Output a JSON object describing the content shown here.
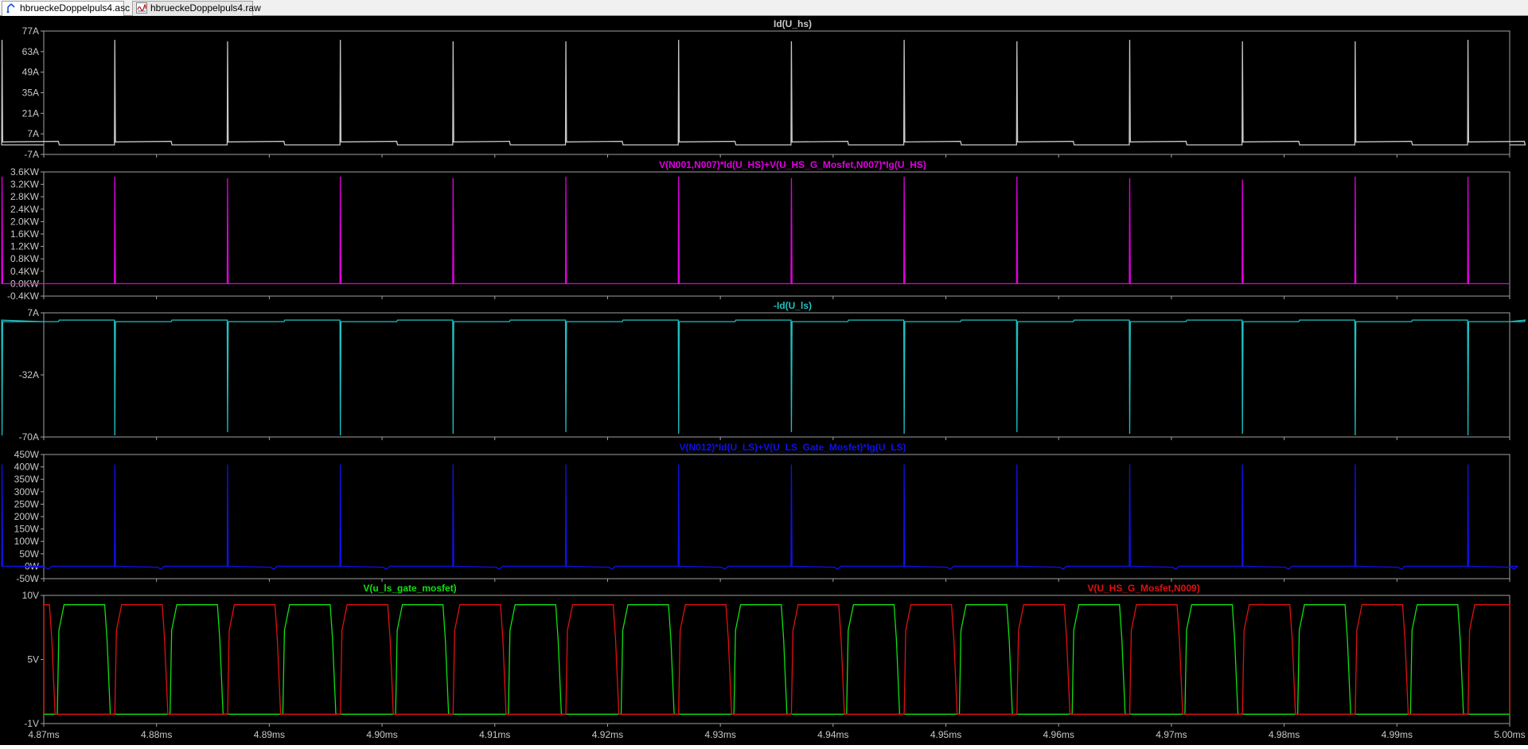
{
  "tabs": [
    {
      "label": "hbrueckeDoppelpuls4.asc",
      "icon": "schematic-icon",
      "active": true
    },
    {
      "label": "hbrueckeDoppelpuls4.raw",
      "icon": "waveform-icon",
      "active": false
    }
  ],
  "x_axis": {
    "range": [
      4.87,
      5.0
    ],
    "ticks": [
      "4.87ms",
      "4.88ms",
      "4.89ms",
      "4.90ms",
      "4.91ms",
      "4.92ms",
      "4.93ms",
      "4.94ms",
      "4.95ms",
      "4.96ms",
      "4.97ms",
      "4.98ms",
      "4.99ms",
      "5.00ms"
    ]
  },
  "chart_data": [
    {
      "type": "line",
      "series": [
        {
          "name": "Id(U_hs)",
          "color": "#c8c8c8",
          "unit": "A"
        }
      ],
      "ylim": [
        -7,
        77
      ],
      "yticks": [
        "77A",
        "63A",
        "49A",
        "35A",
        "21A",
        "7A",
        "-7A"
      ],
      "x": [
        4.8663,
        4.8763,
        4.8863,
        4.8963,
        4.9063,
        4.9163,
        4.9263,
        4.9363,
        4.9463,
        4.9563,
        4.9663,
        4.9763,
        4.9863,
        4.9963
      ],
      "peaks": [
        71,
        71,
        70,
        71,
        70,
        70,
        71,
        70,
        71,
        70,
        71,
        70,
        70,
        71
      ],
      "period_ms": 0.01,
      "on_ms": 0.005,
      "baseline_on": 1.5,
      "baseline_off": -0.5
    },
    {
      "type": "line",
      "series": [
        {
          "name": "V(N001,N007)*Id(U_HS)+V(U_HS_G_Mosfet,N007)*Ig(U_HS)",
          "color": "#e000e0",
          "unit": "W"
        }
      ],
      "ylim": [
        -0.4,
        3.6
      ],
      "yticks": [
        "3.6KW",
        "3.2KW",
        "2.8KW",
        "2.4KW",
        "2.0KW",
        "1.6KW",
        "1.2KW",
        "0.8KW",
        "0.4KW",
        "0.0KW",
        "-0.4KW"
      ],
      "x": [
        4.8663,
        4.8763,
        4.8863,
        4.8963,
        4.9063,
        4.9163,
        4.9263,
        4.9363,
        4.9463,
        4.9563,
        4.9663,
        4.9763,
        4.9863,
        4.9963
      ],
      "peaks": [
        3.45,
        3.45,
        3.4,
        3.45,
        3.4,
        3.45,
        3.45,
        3.4,
        3.45,
        3.45,
        3.4,
        3.35,
        3.45,
        3.45
      ],
      "baseline": 0.0
    },
    {
      "type": "line",
      "series": [
        {
          "name": "-Id(U_ls)",
          "color": "#20c0c0",
          "unit": "A"
        }
      ],
      "ylim": [
        -70,
        7
      ],
      "yticks": [
        "7A",
        "-32A",
        "-70A"
      ],
      "x": [
        4.8663,
        4.8763,
        4.8863,
        4.8963,
        4.9063,
        4.9163,
        4.9263,
        4.9363,
        4.9463,
        4.9563,
        4.9663,
        4.9763,
        4.9863,
        4.9963
      ],
      "troughs": [
        -69,
        -69,
        -67,
        -69,
        -68,
        -67,
        -68,
        -67,
        -68,
        -67,
        -68,
        -68,
        -69,
        -69
      ],
      "baseline_on": 2.5,
      "baseline_off": 1.5
    },
    {
      "type": "line",
      "series": [
        {
          "name": "V(N012)*Id(U_LS)+V(U_LS_Gate_Mosfet)*Ig(U_LS)",
          "color": "#1010e8",
          "unit": "W"
        }
      ],
      "ylim": [
        -50,
        450
      ],
      "yticks": [
        "450W",
        "400W",
        "350W",
        "300W",
        "250W",
        "200W",
        "150W",
        "100W",
        "50W",
        "0W",
        "-50W"
      ],
      "x": [
        4.8663,
        4.8763,
        4.8863,
        4.8963,
        4.9063,
        4.9163,
        4.9263,
        4.9363,
        4.9463,
        4.9563,
        4.9663,
        4.9763,
        4.9863,
        4.9963
      ],
      "peaks": [
        410,
        410,
        410,
        410,
        410,
        410,
        410,
        410,
        410,
        410,
        410,
        410,
        410,
        410
      ],
      "baseline": 0
    },
    {
      "type": "line",
      "series": [
        {
          "name": "V(u_ls_gate_mosfet)",
          "color": "#10e010",
          "high": 9.2,
          "low": -0.2,
          "rise_x0": 4.8712
        },
        {
          "name": "V(U_HS_G_Mosfet,N009)",
          "color": "#e01010",
          "high": 9.2,
          "low": -0.2,
          "rise_x0": 4.8763
        }
      ],
      "ylim": [
        -1,
        10
      ],
      "yticks": [
        "10V",
        "5V",
        "-1V"
      ],
      "period_ms": 0.01,
      "high_ms": 0.0042
    }
  ]
}
